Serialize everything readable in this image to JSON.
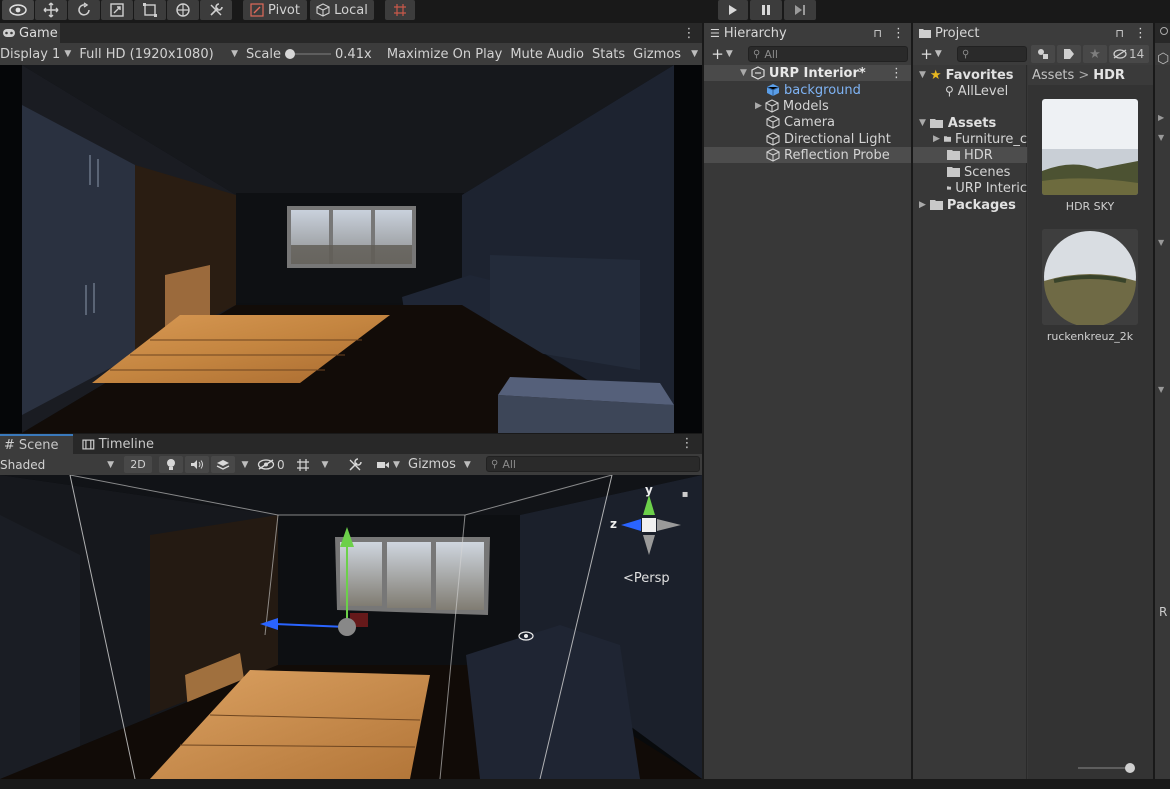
{
  "toolbar": {
    "pivot_label": "Pivot",
    "local_label": "Local"
  },
  "game": {
    "tab_label": "Game",
    "display": "Display 1",
    "resolution": "Full HD (1920x1080)",
    "scale_label": "Scale",
    "scale_value": "0.41x",
    "maximize_label": "Maximize On Play",
    "mute_label": "Mute Audio",
    "stats_label": "Stats",
    "gizmos_label": "Gizmos"
  },
  "scene": {
    "tab_label": "Scene",
    "timeline_label": "Timeline",
    "shading": "Shaded",
    "mode_2d": "2D",
    "hidden_count": "0",
    "gizmos_label": "Gizmos",
    "search_placeholder": "All",
    "persp_label": "Persp",
    "axis_y": "y",
    "axis_z": "z"
  },
  "hierarchy": {
    "title": "Hierarchy",
    "search_placeholder": "All",
    "scene_name": "URP Interior*",
    "items": [
      {
        "label": "background"
      },
      {
        "label": "Models"
      },
      {
        "label": "Camera"
      },
      {
        "label": "Directional Light"
      },
      {
        "label": "Reflection Probe"
      }
    ]
  },
  "project": {
    "title": "Project",
    "hidden_count": "14",
    "favorites_label": "Favorites",
    "favorites_items": [
      "AllLevel"
    ],
    "assets_label": "Assets",
    "assets_items": [
      "Furniture_c",
      "HDR",
      "Scenes",
      "URP Interic"
    ],
    "packages_label": "Packages",
    "breadcrumb_root": "Assets",
    "breadcrumb_sep": ">",
    "breadcrumb_current": "HDR",
    "files": [
      {
        "name": "HDR SKY"
      },
      {
        "name": "ruckenkreuz_2k"
      }
    ]
  },
  "inspector_strip": {
    "letter": "R"
  },
  "colors": {
    "accent_blue": "#3a79bb",
    "selected_text": "#7fb4f5",
    "folder": "#c8c8c8",
    "star": "#e8b820"
  }
}
